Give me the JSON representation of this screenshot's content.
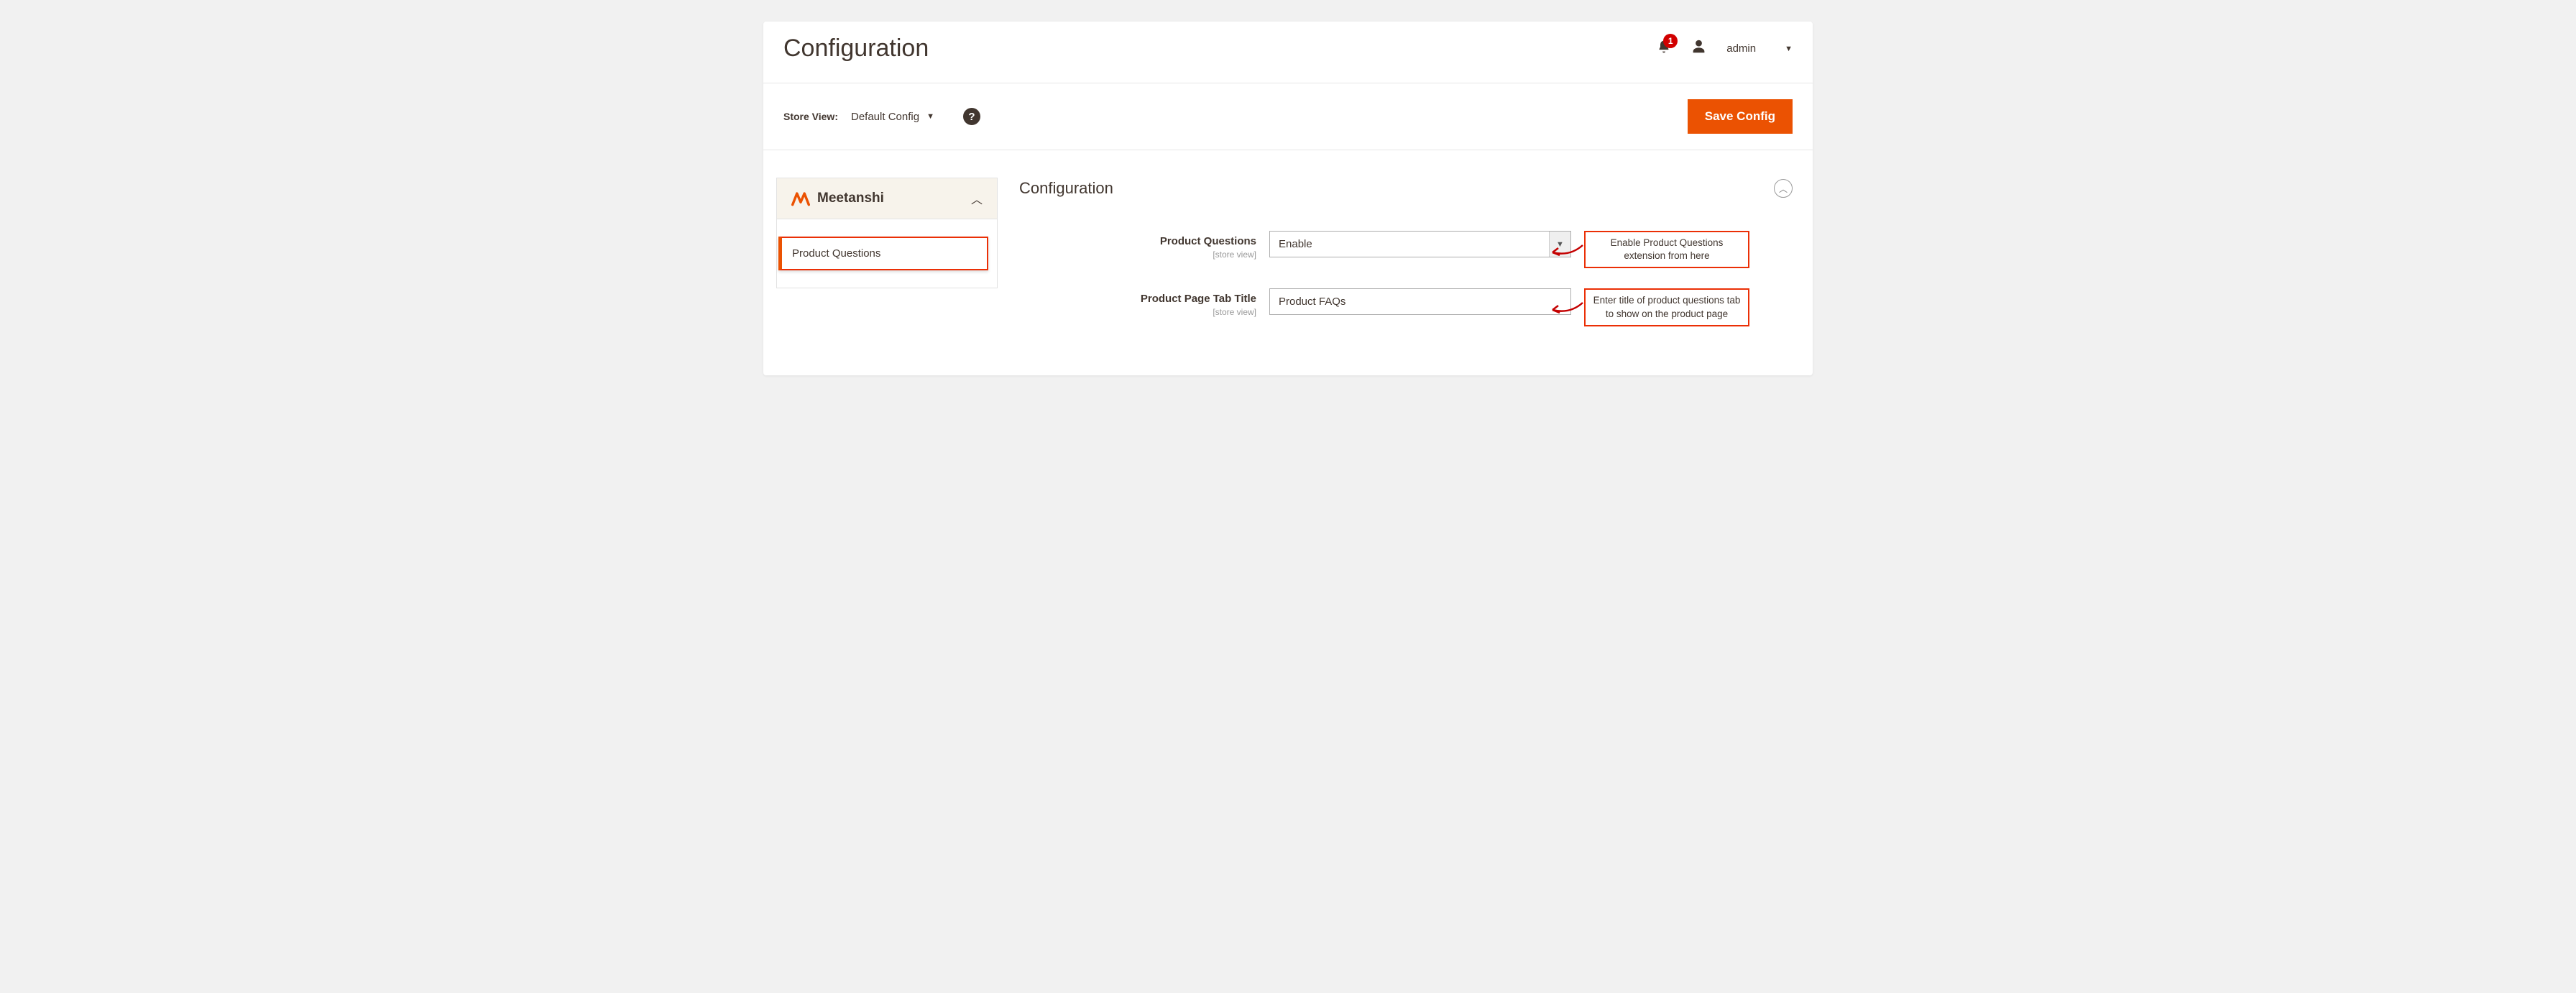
{
  "header": {
    "title": "Configuration",
    "notification_count": "1",
    "admin_label": "admin"
  },
  "toolbar": {
    "store_view_label": "Store View:",
    "store_view_value": "Default Config",
    "save_label": "Save Config"
  },
  "sidebar": {
    "group_name": "Meetanshi",
    "item_name": "Product Questions"
  },
  "section": {
    "title": "Configuration"
  },
  "fields": {
    "enable": {
      "label": "Product Questions",
      "scope": "[store view]",
      "value": "Enable",
      "annotation": "Enable Product Questions extension from here"
    },
    "tab_title": {
      "label": "Product Page Tab Title",
      "scope": "[store view]",
      "value": "Product FAQs",
      "annotation": "Enter title of product questions tab to show on the product page"
    }
  }
}
